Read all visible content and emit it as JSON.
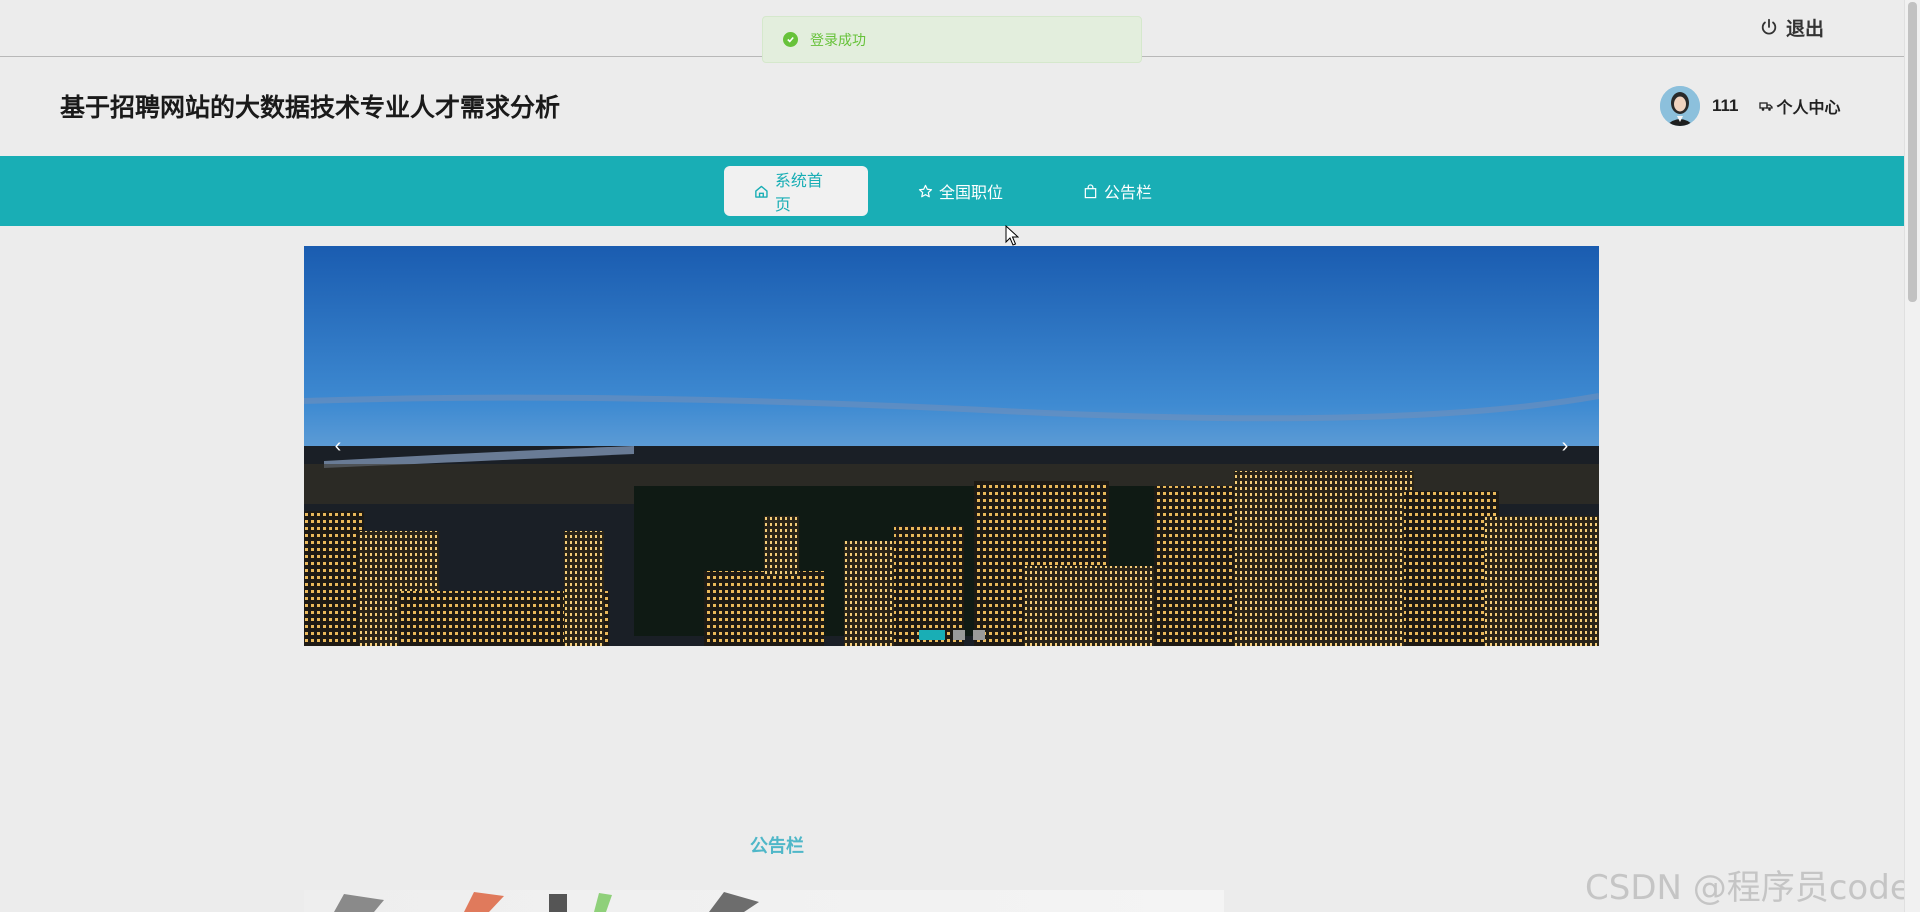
{
  "toast": {
    "message": "登录成功"
  },
  "topbar": {
    "logout_label": "退出"
  },
  "header": {
    "site_title": "基于招聘网站的大数据技术专业人才需求分析",
    "username": "111",
    "user_center_label": "个人中心"
  },
  "nav": {
    "items": [
      {
        "label": "系统首页",
        "icon": "home-icon",
        "active": true
      },
      {
        "label": "全国职位",
        "icon": "star-icon",
        "active": false
      },
      {
        "label": "公告栏",
        "icon": "bag-icon",
        "active": false
      }
    ]
  },
  "carousel": {
    "prev_label": "‹",
    "next_label": "›",
    "slides_count": 3,
    "active_index": 0
  },
  "notice": {
    "heading": "公告栏"
  },
  "watermark": "CSDN @程序员code",
  "colors": {
    "accent": "#19aeb5",
    "success": "#67c23a"
  }
}
